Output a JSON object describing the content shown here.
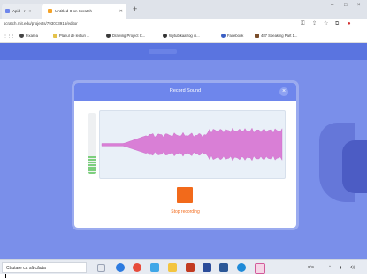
{
  "browser": {
    "tabs": [
      {
        "label": "Apid · r · ×"
      },
      {
        "label": "Untitled-8 on Scratch"
      }
    ],
    "new_tab_label": "+",
    "window_controls": [
      "–",
      "□",
      "×"
    ],
    "url": "scratch.mit.edu/projects/793013916/editor",
    "bookmarks": [
      {
        "label": "Fixarea"
      },
      {
        "label": "Planul de lecturi ..."
      },
      {
        "label": "Drawing Project C..."
      },
      {
        "label": "Wytubikaafrog ib..."
      },
      {
        "label": "Facebook"
      },
      {
        "label": "487 Speaking Part 1..."
      }
    ]
  },
  "dialog": {
    "title": "Record Sound",
    "close_label": "×",
    "stop_label": "Stop recording",
    "level_fraction": 0.3
  },
  "taskbar": {
    "search_placeholder": "Căutare ca să căuta",
    "weather": "9°C",
    "tray_icons": [
      "^",
      "▮",
      "4))"
    ]
  },
  "colors": {
    "scratch_blue": "#7a8fea",
    "dialog_header": "#6e86ec",
    "waveform": "#d97fd6",
    "record_orange": "#f26a1b",
    "meter_green": "#7dcf7d"
  }
}
